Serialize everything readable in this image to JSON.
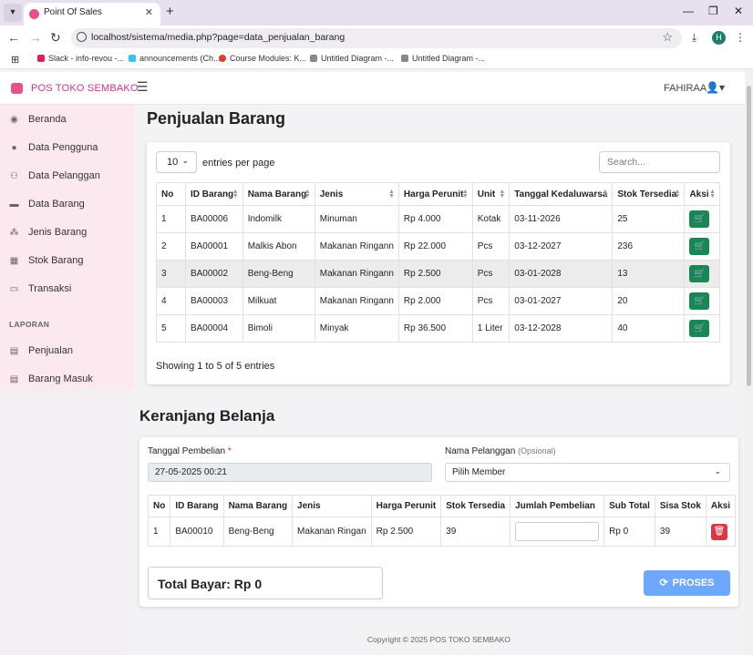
{
  "browser": {
    "tab_title": "Point Of Sales",
    "url": "localhost/sistema/media.php?page=data_penjualan_barang",
    "profile_initial": "H",
    "bookmarks": [
      "Slack - info-revou -...",
      "announcements (Ch...",
      "Course Modules: K...",
      "Untitled Diagram -...",
      "Untitled Diagram -..."
    ]
  },
  "header": {
    "brand": "POS TOKO SEMBAKO",
    "user": "FAHIRAA"
  },
  "sidebar": {
    "items": [
      {
        "label": "Beranda",
        "icon": "tachometer-icon"
      },
      {
        "label": "Data Pengguna",
        "icon": "user-icon"
      },
      {
        "label": "Data Pelanggan",
        "icon": "users-icon"
      },
      {
        "label": "Data Barang",
        "icon": "box-icon"
      },
      {
        "label": "Jenis Barang",
        "icon": "cubes-icon"
      },
      {
        "label": "Stok Barang",
        "icon": "boxes-icon"
      },
      {
        "label": "Transaksi",
        "icon": "cash-icon"
      }
    ],
    "section": "LAPORAN",
    "report_items": [
      {
        "label": "Penjualan",
        "icon": "table-icon"
      },
      {
        "label": "Barang Masuk",
        "icon": "table-icon"
      }
    ]
  },
  "products": {
    "title": "Penjualan Barang",
    "entries_value": "10",
    "entries_label": "entries per page",
    "search_placeholder": "Search...",
    "columns": [
      "No",
      "ID Barang",
      "Nama Barang",
      "Jenis",
      "Harga Perunit",
      "Unit",
      "Tanggal Kedaluwarsa",
      "Stok Tersedia",
      "Aksi"
    ],
    "rows": [
      [
        "1",
        "BA00006",
        "Indomilk",
        "Minuman",
        "Rp 4.000",
        "Kotak",
        "03-11-2026",
        "25"
      ],
      [
        "2",
        "BA00001",
        "Malkis Abon",
        "Makanan Ringann",
        "Rp 22.000",
        "Pcs",
        "03-12-2027",
        "236"
      ],
      [
        "3",
        "BA00002",
        "Beng-Beng",
        "Makanan Ringann",
        "Rp 2.500",
        "Pcs",
        "03-01-2028",
        "13"
      ],
      [
        "4",
        "BA00003",
        "Milkuat",
        "Makanan Ringann",
        "Rp 2.000",
        "Pcs",
        "03-01-2027",
        "20"
      ],
      [
        "5",
        "BA00004",
        "Bimoli",
        "Minyak",
        "Rp 36.500",
        "1 Liter",
        "03-12-2028",
        "40"
      ]
    ],
    "showing": "Showing 1 to 5 of 5 entries"
  },
  "cart": {
    "title": "Keranjang Belanja",
    "date_label": "Tanggal Pembelian",
    "date_value": "27-05-2025 00:21",
    "customer_label": "Nama Pelanggan",
    "customer_optional": "(Opsional)",
    "customer_value": "Pilih Member",
    "columns": [
      "No",
      "ID Barang",
      "Nama Barang",
      "Jenis",
      "Harga Perunit",
      "Stok Tersedia",
      "Jumlah Pembelian",
      "Sub Total",
      "Sisa Stok",
      "Aksi"
    ],
    "rows": [
      [
        "1",
        "BA00010",
        "Beng-Beng",
        "Makanan Ringan",
        "Rp 2.500",
        "39",
        "",
        "Rp 0",
        "39"
      ]
    ],
    "total": "Total Bayar: Rp 0",
    "process_label": "PROSES"
  },
  "footer": "Copyright © 2025 POS TOKO SEMBAKO",
  "colors": {
    "brand": "#d63384",
    "sidebar_bg": "#fce8ef",
    "cart_button": "#198754",
    "delete_button": "#dc3545",
    "process_button": "#6ea8fe"
  }
}
